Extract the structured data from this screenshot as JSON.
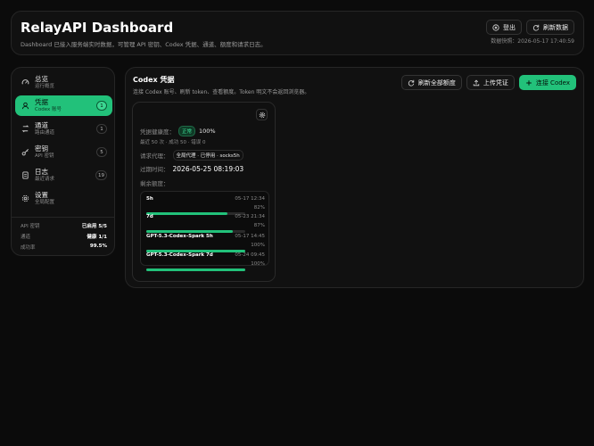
{
  "header": {
    "title": "RelayAPI Dashboard",
    "subtitle": "Dashboard 已接入服务端实时数据，可管理 API 密钥、Codex 凭据、通道、额度和请求日志。",
    "logout_label": "登出",
    "refresh_label": "刷新数据",
    "snapshot": "数据快照：2026-05-17 17:40:59"
  },
  "sidebar": {
    "items": [
      {
        "label": "总览",
        "sub": "运行概览",
        "count": "",
        "icon": "gauge-icon"
      },
      {
        "label": "凭据",
        "sub": "Codex 账号",
        "count": "1",
        "icon": "user-icon"
      },
      {
        "label": "通道",
        "sub": "路由通道",
        "count": "1",
        "icon": "route-icon"
      },
      {
        "label": "密钥",
        "sub": "API 密钥",
        "count": "5",
        "icon": "key-icon"
      },
      {
        "label": "日志",
        "sub": "最近请求",
        "count": "19",
        "icon": "doc-icon"
      },
      {
        "label": "设置",
        "sub": "全局配置",
        "count": "",
        "icon": "gear-icon"
      }
    ],
    "stats": [
      {
        "label": "API 密钥",
        "value": "已启用 5/5"
      },
      {
        "label": "通道",
        "value": "健康 1/1"
      },
      {
        "label": "成功率",
        "value": "99.5%"
      }
    ]
  },
  "main": {
    "title": "Codex 凭据",
    "subtitle": "连接 Codex 账号、刷新 token、查看额度。Token 明文不会返回浏览器。",
    "refresh_all_label": "刷新全部额度",
    "upload_label": "上传凭证",
    "connect_label": "连接 Codex"
  },
  "credential": {
    "health_label": "凭据健康度：",
    "health_badge": "正常",
    "health_pct": "100%",
    "recent": "最近 50 次 · 成功 50 · 错误 0",
    "proxy_label": "请求代理：",
    "proxy_value": "全局代理 · 已停用 · socks5h",
    "expire_label": "过期时间：",
    "expire_value": "2026-05-25 08:19:03",
    "quota_label": "剩余额度：",
    "quotas": [
      {
        "name": "5h",
        "time": "05-17 12:34",
        "pct_label": "82%",
        "pct": 82
      },
      {
        "name": "7d",
        "time": "05-23 21:34",
        "pct_label": "87%",
        "pct": 87
      },
      {
        "name": "GPT-5.3-Codex-Spark 5h",
        "time": "05-17 14:45",
        "pct_label": "100%",
        "pct": 100
      },
      {
        "name": "GPT-5.3-Codex-Spark 7d",
        "time": "05-24 09:45",
        "pct_label": "100%",
        "pct": 100
      }
    ]
  },
  "colors": {
    "accent": "#22c17a",
    "background": "#0b0b0b",
    "card": "#111111"
  }
}
